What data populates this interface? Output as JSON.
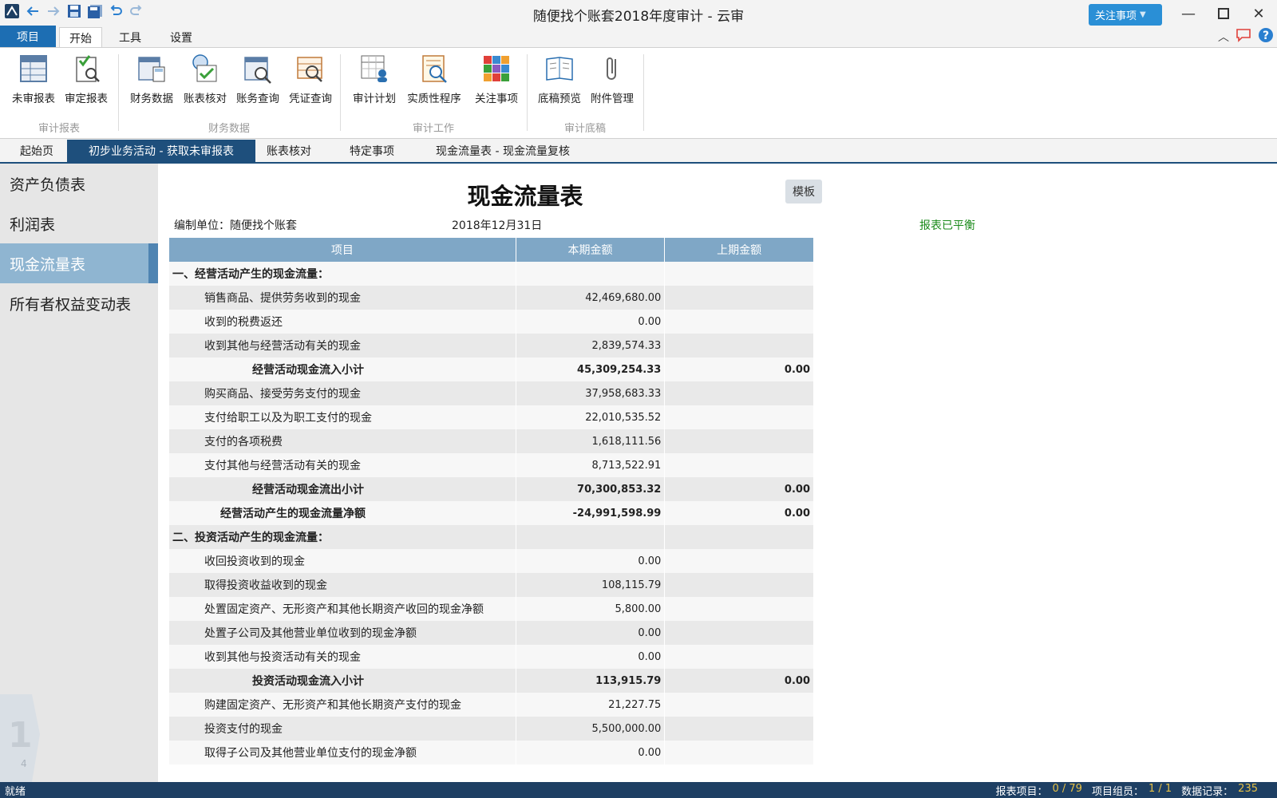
{
  "window": {
    "title": "随便找个账套2018年度审计 - 云审",
    "attention_button": "关注事项"
  },
  "ribbon_tabs": {
    "project": "项目",
    "tabs": [
      "开始",
      "工具",
      "设置"
    ]
  },
  "ribbon": {
    "buttons": [
      {
        "label": "未审报表",
        "icon": "unaudited-report-icon"
      },
      {
        "label": "审定报表",
        "icon": "audited-report-icon"
      },
      {
        "label": "财务数据",
        "icon": "financial-data-icon"
      },
      {
        "label": "账表核对",
        "icon": "ledger-check-icon"
      },
      {
        "label": "账务查询",
        "icon": "account-query-icon"
      },
      {
        "label": "凭证查询",
        "icon": "voucher-query-icon"
      },
      {
        "label": "审计计划",
        "icon": "audit-plan-icon"
      },
      {
        "label": "实质性程序",
        "icon": "substantive-procedure-icon"
      },
      {
        "label": "关注事项",
        "icon": "attention-items-icon"
      },
      {
        "label": "底稿预览",
        "icon": "workpaper-preview-icon"
      },
      {
        "label": "附件管理",
        "icon": "attachment-icon"
      }
    ],
    "groups": [
      "审计报表",
      "财务数据",
      "审计工作",
      "审计底稿"
    ]
  },
  "doc_tabs": [
    "起始页",
    "初步业务活动 - 获取未审报表",
    "账表核对",
    "特定事项",
    "现金流量表 - 现金流量复核"
  ],
  "sidebar": {
    "items": [
      "资产负债表",
      "利润表",
      "现金流量表",
      "所有者权益变动表"
    ],
    "page_current": "1",
    "page_total": "4"
  },
  "report": {
    "title": "现金流量表",
    "template_button": "模板",
    "compiler": "编制单位：随便找个账套",
    "date": "2018年12月31日",
    "status": "报表已平衡",
    "columns": [
      "项目",
      "本期金额",
      "上期金额"
    ],
    "rows": [
      {
        "item": "一、经营活动产生的现金流量：",
        "current": "",
        "prior": "",
        "level": 0,
        "bold": true
      },
      {
        "item": "销售商品、提供劳务收到的现金",
        "current": "42,469,680.00",
        "prior": "",
        "level": 1,
        "bold": false
      },
      {
        "item": "收到的税费返还",
        "current": "0.00",
        "prior": "",
        "level": 1,
        "bold": false
      },
      {
        "item": "收到其他与经营活动有关的现金",
        "current": "2,839,574.33",
        "prior": "",
        "level": 1,
        "bold": false
      },
      {
        "item": "经营活动现金流入小计",
        "current": "45,309,254.33",
        "prior": "0.00",
        "level": 3,
        "bold": true
      },
      {
        "item": "购买商品、接受劳务支付的现金",
        "current": "37,958,683.33",
        "prior": "",
        "level": 1,
        "bold": false
      },
      {
        "item": "支付给职工以及为职工支付的现金",
        "current": "22,010,535.52",
        "prior": "",
        "level": 1,
        "bold": false
      },
      {
        "item": "支付的各项税费",
        "current": "1,618,111.56",
        "prior": "",
        "level": 1,
        "bold": false
      },
      {
        "item": "支付其他与经营活动有关的现金",
        "current": "8,713,522.91",
        "prior": "",
        "level": 1,
        "bold": false
      },
      {
        "item": "经营活动现金流出小计",
        "current": "70,300,853.32",
        "prior": "0.00",
        "level": 3,
        "bold": true
      },
      {
        "item": "经营活动产生的现金流量净额",
        "current": "-24,991,598.99",
        "prior": "0.00",
        "level": 2,
        "bold": true
      },
      {
        "item": "二、投资活动产生的现金流量：",
        "current": "",
        "prior": "",
        "level": 0,
        "bold": true
      },
      {
        "item": "收回投资收到的现金",
        "current": "0.00",
        "prior": "",
        "level": 1,
        "bold": false
      },
      {
        "item": "取得投资收益收到的现金",
        "current": "108,115.79",
        "prior": "",
        "level": 1,
        "bold": false
      },
      {
        "item": "处置固定资产、无形资产和其他长期资产收回的现金净额",
        "current": "5,800.00",
        "prior": "",
        "level": 1,
        "bold": false
      },
      {
        "item": "处置子公司及其他营业单位收到的现金净额",
        "current": "0.00",
        "prior": "",
        "level": 1,
        "bold": false
      },
      {
        "item": "收到其他与投资活动有关的现金",
        "current": "0.00",
        "prior": "",
        "level": 1,
        "bold": false
      },
      {
        "item": "投资活动现金流入小计",
        "current": "113,915.79",
        "prior": "0.00",
        "level": 3,
        "bold": true
      },
      {
        "item": "购建固定资产、无形资产和其他长期资产支付的现金",
        "current": "21,227.75",
        "prior": "",
        "level": 1,
        "bold": false
      },
      {
        "item": "投资支付的现金",
        "current": "5,500,000.00",
        "prior": "",
        "level": 1,
        "bold": false
      },
      {
        "item": "取得子公司及其他营业单位支付的现金净额",
        "current": "0.00",
        "prior": "",
        "level": 1,
        "bold": false
      }
    ]
  },
  "statusbar": {
    "left": "就绪",
    "report_items_label": "报表项目：",
    "report_items_value": "0 / 79",
    "members_label": "项目组员：",
    "members_value": "1 / 1",
    "records_label": "数据记录：",
    "records_value": "235"
  },
  "colors": {
    "accent": "#1d6eb3",
    "doc_tab_active": "#1e4f7c",
    "table_header": "#7fa7c6",
    "status_ok": "#1a8a1a"
  }
}
